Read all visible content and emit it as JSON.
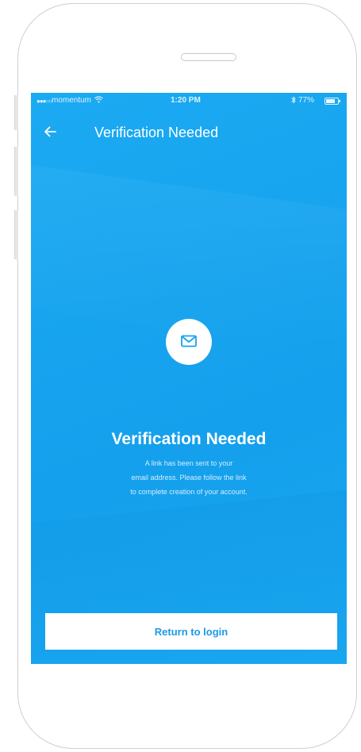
{
  "status_bar": {
    "signal": "●●●○○",
    "carrier": "momentum",
    "time": "1:20 PM",
    "battery_percent": "77%"
  },
  "nav": {
    "back_icon": "arrow-left-icon",
    "title": "Verification Needed"
  },
  "content": {
    "icon": "mail-icon",
    "heading": "Verification Needed",
    "message_lines": [
      "A  link has been sent  to your",
      "email address. Please follow the link",
      "to complete creation of your account."
    ]
  },
  "actions": {
    "return_label": "Return to login"
  },
  "colors": {
    "primary": "#17a3ee",
    "button_text": "#1a9be6",
    "white": "#ffffff"
  }
}
